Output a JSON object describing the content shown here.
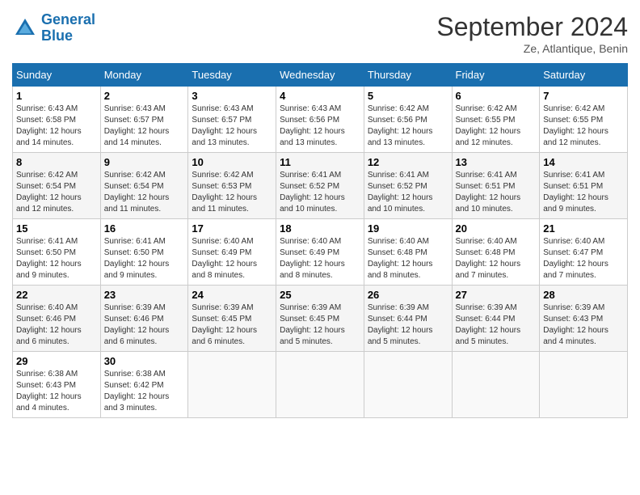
{
  "header": {
    "logo_line1": "General",
    "logo_line2": "Blue",
    "month_title": "September 2024",
    "subtitle": "Ze, Atlantique, Benin"
  },
  "days_of_week": [
    "Sunday",
    "Monday",
    "Tuesday",
    "Wednesday",
    "Thursday",
    "Friday",
    "Saturday"
  ],
  "weeks": [
    [
      {
        "day": "1",
        "sunrise": "6:43 AM",
        "sunset": "6:58 PM",
        "daylight": "12 hours and 14 minutes."
      },
      {
        "day": "2",
        "sunrise": "6:43 AM",
        "sunset": "6:57 PM",
        "daylight": "12 hours and 14 minutes."
      },
      {
        "day": "3",
        "sunrise": "6:43 AM",
        "sunset": "6:57 PM",
        "daylight": "12 hours and 13 minutes."
      },
      {
        "day": "4",
        "sunrise": "6:43 AM",
        "sunset": "6:56 PM",
        "daylight": "12 hours and 13 minutes."
      },
      {
        "day": "5",
        "sunrise": "6:42 AM",
        "sunset": "6:56 PM",
        "daylight": "12 hours and 13 minutes."
      },
      {
        "day": "6",
        "sunrise": "6:42 AM",
        "sunset": "6:55 PM",
        "daylight": "12 hours and 12 minutes."
      },
      {
        "day": "7",
        "sunrise": "6:42 AM",
        "sunset": "6:55 PM",
        "daylight": "12 hours and 12 minutes."
      }
    ],
    [
      {
        "day": "8",
        "sunrise": "6:42 AM",
        "sunset": "6:54 PM",
        "daylight": "12 hours and 12 minutes."
      },
      {
        "day": "9",
        "sunrise": "6:42 AM",
        "sunset": "6:54 PM",
        "daylight": "12 hours and 11 minutes."
      },
      {
        "day": "10",
        "sunrise": "6:42 AM",
        "sunset": "6:53 PM",
        "daylight": "12 hours and 11 minutes."
      },
      {
        "day": "11",
        "sunrise": "6:41 AM",
        "sunset": "6:52 PM",
        "daylight": "12 hours and 10 minutes."
      },
      {
        "day": "12",
        "sunrise": "6:41 AM",
        "sunset": "6:52 PM",
        "daylight": "12 hours and 10 minutes."
      },
      {
        "day": "13",
        "sunrise": "6:41 AM",
        "sunset": "6:51 PM",
        "daylight": "12 hours and 10 minutes."
      },
      {
        "day": "14",
        "sunrise": "6:41 AM",
        "sunset": "6:51 PM",
        "daylight": "12 hours and 9 minutes."
      }
    ],
    [
      {
        "day": "15",
        "sunrise": "6:41 AM",
        "sunset": "6:50 PM",
        "daylight": "12 hours and 9 minutes."
      },
      {
        "day": "16",
        "sunrise": "6:41 AM",
        "sunset": "6:50 PM",
        "daylight": "12 hours and 9 minutes."
      },
      {
        "day": "17",
        "sunrise": "6:40 AM",
        "sunset": "6:49 PM",
        "daylight": "12 hours and 8 minutes."
      },
      {
        "day": "18",
        "sunrise": "6:40 AM",
        "sunset": "6:49 PM",
        "daylight": "12 hours and 8 minutes."
      },
      {
        "day": "19",
        "sunrise": "6:40 AM",
        "sunset": "6:48 PM",
        "daylight": "12 hours and 8 minutes."
      },
      {
        "day": "20",
        "sunrise": "6:40 AM",
        "sunset": "6:48 PM",
        "daylight": "12 hours and 7 minutes."
      },
      {
        "day": "21",
        "sunrise": "6:40 AM",
        "sunset": "6:47 PM",
        "daylight": "12 hours and 7 minutes."
      }
    ],
    [
      {
        "day": "22",
        "sunrise": "6:40 AM",
        "sunset": "6:46 PM",
        "daylight": "12 hours and 6 minutes."
      },
      {
        "day": "23",
        "sunrise": "6:39 AM",
        "sunset": "6:46 PM",
        "daylight": "12 hours and 6 minutes."
      },
      {
        "day": "24",
        "sunrise": "6:39 AM",
        "sunset": "6:45 PM",
        "daylight": "12 hours and 6 minutes."
      },
      {
        "day": "25",
        "sunrise": "6:39 AM",
        "sunset": "6:45 PM",
        "daylight": "12 hours and 5 minutes."
      },
      {
        "day": "26",
        "sunrise": "6:39 AM",
        "sunset": "6:44 PM",
        "daylight": "12 hours and 5 minutes."
      },
      {
        "day": "27",
        "sunrise": "6:39 AM",
        "sunset": "6:44 PM",
        "daylight": "12 hours and 5 minutes."
      },
      {
        "day": "28",
        "sunrise": "6:39 AM",
        "sunset": "6:43 PM",
        "daylight": "12 hours and 4 minutes."
      }
    ],
    [
      {
        "day": "29",
        "sunrise": "6:38 AM",
        "sunset": "6:43 PM",
        "daylight": "12 hours and 4 minutes."
      },
      {
        "day": "30",
        "sunrise": "6:38 AM",
        "sunset": "6:42 PM",
        "daylight": "12 hours and 3 minutes."
      },
      null,
      null,
      null,
      null,
      null
    ]
  ]
}
